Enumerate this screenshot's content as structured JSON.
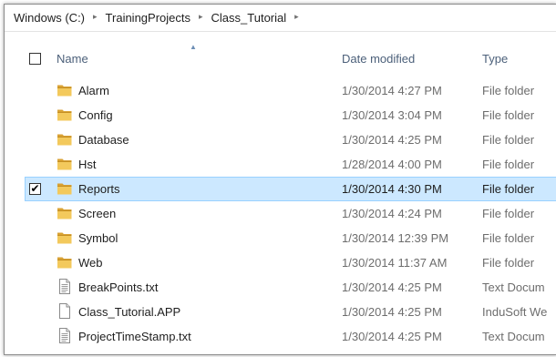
{
  "breadcrumb": {
    "items": [
      "Windows (C:)",
      "TrainingProjects",
      "Class_Tutorial"
    ],
    "separator": "▸"
  },
  "columns": {
    "name": "Name",
    "date": "Date modified",
    "type": "Type"
  },
  "files": [
    {
      "name": "Alarm",
      "date": "1/30/2014 4:27 PM",
      "type": "File folder",
      "icon": "folder-icon",
      "selected": false
    },
    {
      "name": "Config",
      "date": "1/30/2014 3:04 PM",
      "type": "File folder",
      "icon": "folder-icon",
      "selected": false
    },
    {
      "name": "Database",
      "date": "1/30/2014 4:25 PM",
      "type": "File folder",
      "icon": "folder-icon",
      "selected": false
    },
    {
      "name": "Hst",
      "date": "1/28/2014 4:00 PM",
      "type": "File folder",
      "icon": "folder-icon",
      "selected": false
    },
    {
      "name": "Reports",
      "date": "1/30/2014 4:30 PM",
      "type": "File folder",
      "icon": "folder-icon",
      "selected": true
    },
    {
      "name": "Screen",
      "date": "1/30/2014 4:24 PM",
      "type": "File folder",
      "icon": "folder-icon",
      "selected": false
    },
    {
      "name": "Symbol",
      "date": "1/30/2014 12:39 PM",
      "type": "File folder",
      "icon": "folder-icon",
      "selected": false
    },
    {
      "name": "Web",
      "date": "1/30/2014 11:37 AM",
      "type": "File folder",
      "icon": "folder-icon",
      "selected": false
    },
    {
      "name": "BreakPoints.txt",
      "date": "1/30/2014 4:25 PM",
      "type": "Text Docum",
      "icon": "text-document-icon",
      "selected": false
    },
    {
      "name": "Class_Tutorial.APP",
      "date": "1/30/2014 4:25 PM",
      "type": "InduSoft We",
      "icon": "blank-file-icon",
      "selected": false
    },
    {
      "name": "ProjectTimeStamp.txt",
      "date": "1/30/2014 4:25 PM",
      "type": "Text Docum",
      "icon": "text-document-icon",
      "selected": false
    }
  ],
  "colors": {
    "selection_bg": "#cce8ff",
    "selection_border": "#99d1ff",
    "folder": "#e8b84a",
    "header_text": "#4c607a"
  }
}
